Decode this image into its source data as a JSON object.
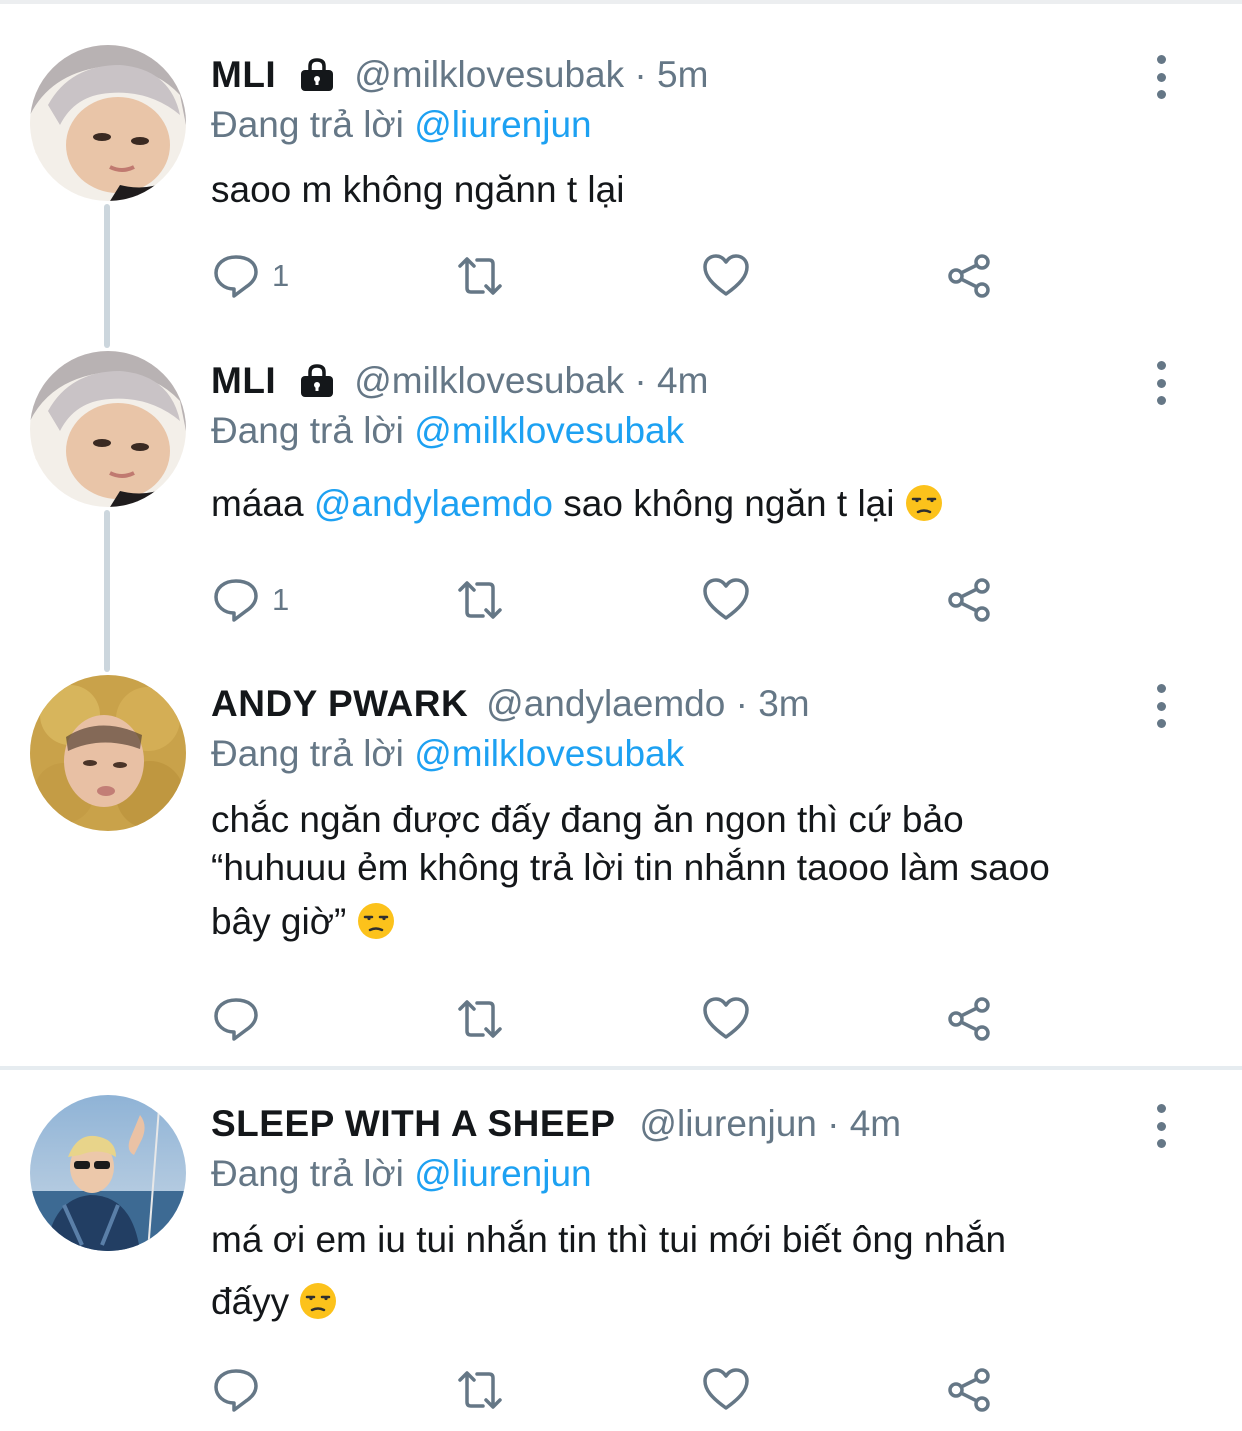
{
  "tweets": [
    {
      "name": "MLI",
      "locked": true,
      "handle_time": "@milklovesubak · 5m",
      "reply_prefix": "Đang trả lời",
      "reply_to": "@liurenjun",
      "text": "saoo m không ngănn t lại",
      "reply_count": "1",
      "avatar_icon": "avatar-mli"
    },
    {
      "name": "MLI",
      "locked": true,
      "handle_time": "@milklovesubak · 4m",
      "reply_prefix": "Đang trả lời",
      "reply_to": "@milklovesubak",
      "text_before": "máaa",
      "text_mention": "@andylaemdo",
      "text_after": "sao không ngăn t lại",
      "reply_count": "1",
      "avatar_icon": "avatar-mli"
    },
    {
      "name": "ANDY PWARK",
      "locked": false,
      "handle_time": "@andylaemdo · 3m",
      "reply_prefix": "Đang trả lời",
      "reply_to": "@milklovesubak",
      "text_line1": "chắc ngăn được đấy đang ăn ngon thì cứ bảo",
      "text_line2": "“huhuuu ẻm không trả lời tin nhắnn taooo làm saoo",
      "text_line3": "bây giờ”",
      "reply_count": "",
      "avatar_icon": "avatar-andy"
    },
    {
      "name": "SLEEP WITH A SHEEP",
      "locked": false,
      "handle_time": "@liurenjun · 4m",
      "reply_prefix": "Đang trả lời",
      "reply_to": "@liurenjun",
      "text_line1": "má ơi em iu tui nhắn tin thì tui mới biết ông nhắn",
      "text_line2": "đấyy",
      "reply_count": "",
      "avatar_icon": "avatar-sheep"
    }
  ],
  "icons": {
    "reply": "comment-icon",
    "retweet": "retweet-icon",
    "like": "heart-icon",
    "share": "share-icon",
    "more": "more-vertical-icon",
    "lock": "lock-icon",
    "emoji": "unamused-face-emoji"
  },
  "colors": {
    "mention": "#1da1f2",
    "secondary": "#657786",
    "thread_line": "#ccd6dd"
  }
}
